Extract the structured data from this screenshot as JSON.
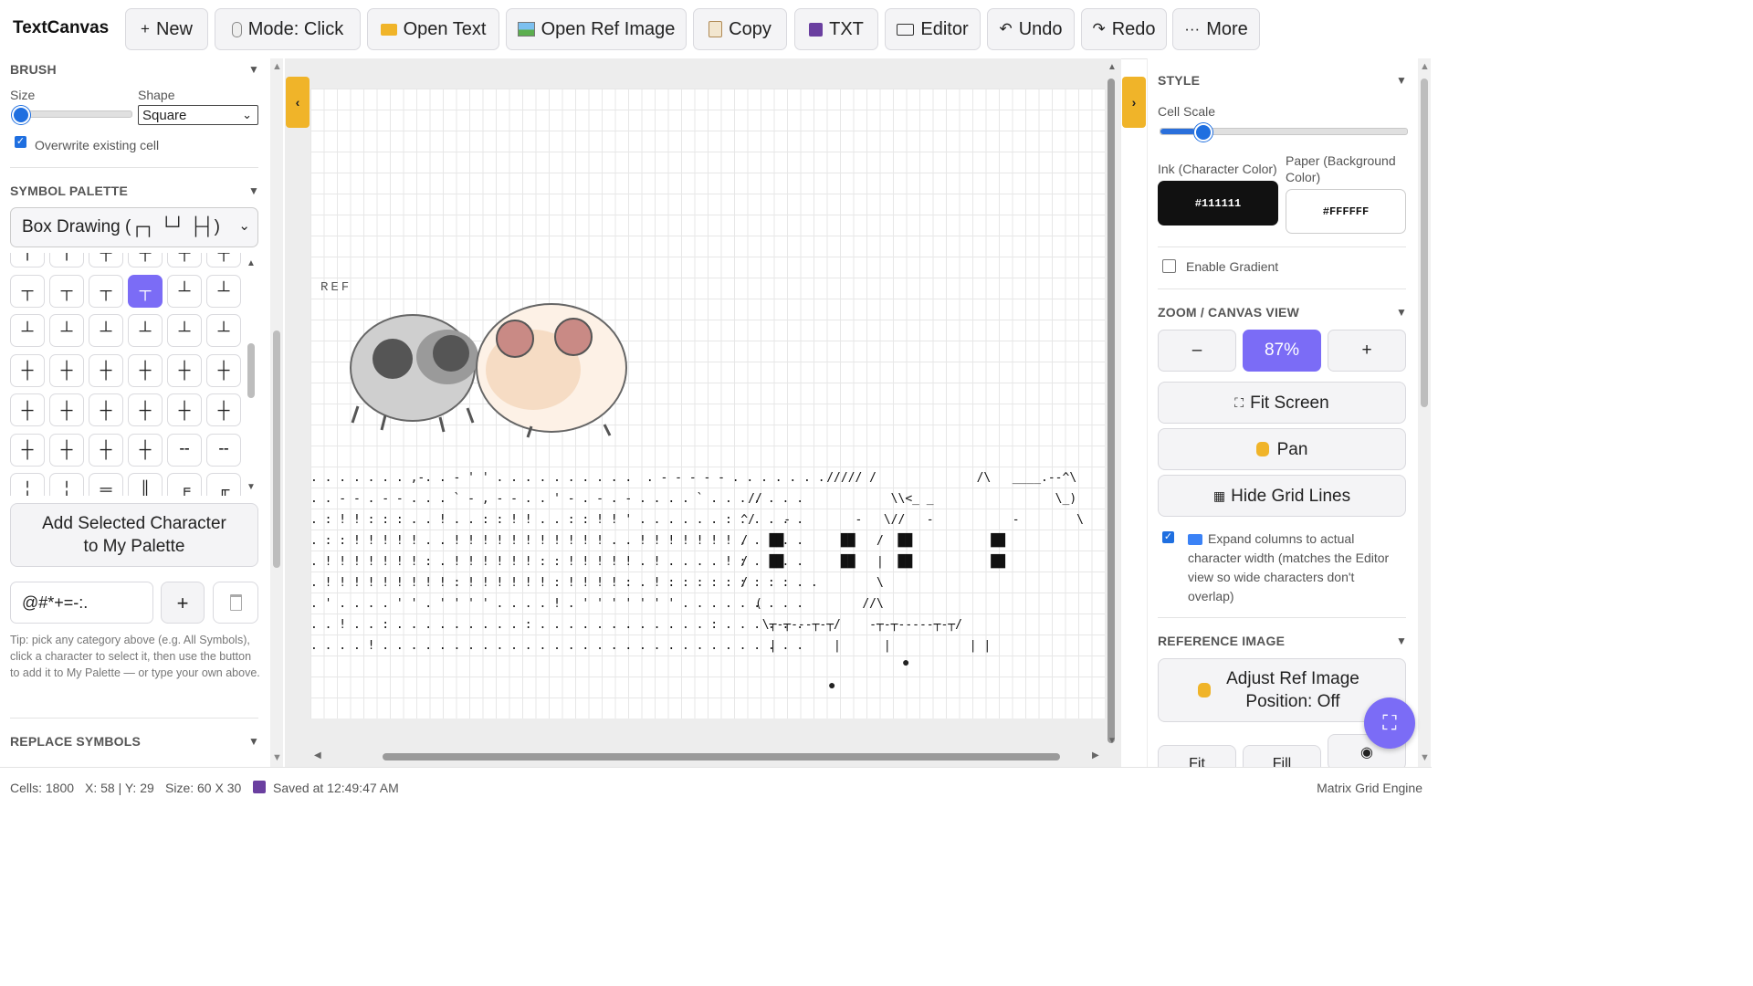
{
  "app": {
    "title": "TextCanvas"
  },
  "toolbar": {
    "new_label": "New",
    "mode_label": "Mode: Click",
    "open_text_label": "Open Text",
    "open_ref_label": "Open Ref Image",
    "copy_label": "Copy",
    "txt_label": "TXT",
    "editor_label": "Editor",
    "undo_label": "Undo",
    "redo_label": "Redo",
    "more_label": "More"
  },
  "brush": {
    "title": "BRUSH",
    "size_label": "Size",
    "size_value": 0.0,
    "shape_label": "Shape",
    "shape_value": "Square",
    "overwrite_label": "Overwrite existing cell",
    "overwrite_checked": true
  },
  "palette": {
    "title": "SYMBOL PALETTE",
    "category": "Box Drawing (┌┐ └┘ ├┤)",
    "symbols": [
      "╷",
      "╷",
      "╤",
      "╤",
      "╤",
      "╤",
      "┬",
      "┬",
      "┬",
      "┬",
      "┴",
      "┴",
      "┴",
      "┴",
      "┴",
      "┴",
      "┴",
      "┴",
      "┼",
      "┼",
      "┼",
      "┼",
      "┼",
      "┼",
      "┼",
      "┼",
      "┼",
      "┼",
      "┼",
      "┼",
      "┼",
      "┼",
      "┼",
      "┼",
      "╌",
      "╌",
      "╎",
      "╎",
      "═",
      "║",
      "╒",
      "╓"
    ],
    "selected_index": 9,
    "add_button": "Add Selected Character to My Palette",
    "custom_value": "@#*+=-:.",
    "add_icon": "+",
    "tip": "Tip: pick any category above (e.g. All Symbols), click a character to select it, then use the button to add it to My Palette — or type your own above."
  },
  "replace": {
    "title": "REPLACE SYMBOLS"
  },
  "canvas": {
    "ref_label": "REF",
    "art_left": ". . . . . . . ,-. . - ' ' . . . . . . . . . .  . - - - - - . . . . . . .\n. . - - . - - . . . ` - , - - . . ' - . - . - . . . . ` . . . . . . .\n. : ! ! : : : . . ! . . : : ! ! . . : : ! ! ' . . . . . . : . . . . .\n. : : ! ! ! ! ! . . ! ! ! ! ! ! ! ! ! ! ! . . ! ! ! ! ! ! ! . . . . .\n. ! ! ! ! ! ! ! : . ! ! ! ! ! ! : : ! ! ! ! ! . ! . . . . ! : . . . .\n. ! ! ! ! ! ! ! ! ! : ! ! ! ! ! ! : ! ! ! ! : . ! : : : : : : : : : . .\n. ' . . . . ' ' . ' ' ' ' . . . . ! . ' ' ' ' ' ' ' . . . . . . . . .\n. . ! . . : . . . . . . . . . : . . . . . . . . . . . . : . . . . . .\n. . . . ! . . . . . . . . . . . . . . . . . . . . . . . . . . . . . .",
    "art_right": "                ///// /              /\\   ____.--^\\\n     //                  \\\\<_ _                 \\_)\n    ^/    -         -   \\//   -           -        \\\n    /   ██        ██   /  ██           ██\n    /   ██        ██   |  ██           ██\n    /                  \\\n      (              //\\\n       \\┬-┬---┬-┬/    -┬-┬-----┬-┬/\n        |        |      |           | |",
    "fruit_1": "●",
    "fruit_2": "●"
  },
  "style": {
    "title": "STYLE",
    "cell_scale_label": "Cell Scale",
    "cell_scale_value": 0.14,
    "ink_label": "Ink (Character Color)",
    "ink_value": "#111111",
    "paper_label": "Paper (Background Color)",
    "paper_value": "#FFFFFF",
    "gradient_label": "Enable Gradient",
    "gradient_checked": false
  },
  "zoom": {
    "title": "ZOOM / CANVAS VIEW",
    "minus_label": "–",
    "value": "87%",
    "plus_label": "+",
    "fit_label": "Fit Screen",
    "pan_label": "Pan",
    "grid_label": "Hide Grid Lines",
    "expand_label": "Expand columns to actual character width (matches the Editor view so wide characters don't overlap)",
    "expand_checked": true
  },
  "reference": {
    "title": "REFERENCE IMAGE",
    "adjust_label": "Adjust Ref Image Position: Off",
    "fit_label": "Fit",
    "fill_label": "Fill"
  },
  "status": {
    "cells": "Cells: 1800",
    "coords": "X: 58 | Y: 29",
    "size": "Size: 60 X 30",
    "saved": "Saved at 12:49:47 AM",
    "engine": "Matrix Grid Engine"
  },
  "colors": {
    "accent": "#7b6cf6",
    "tab": "#f0b429",
    "ink": "#111111",
    "paper": "#FFFFFF"
  }
}
